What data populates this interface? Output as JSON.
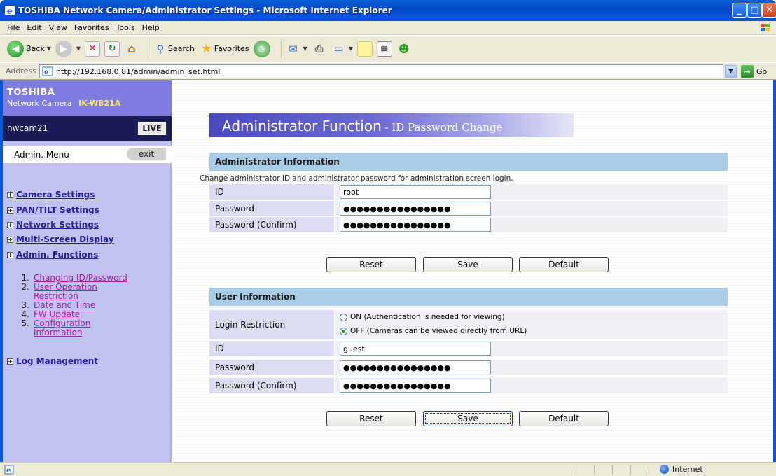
{
  "window": {
    "title": "TOSHIBA Network Camera/Administrator Settings - Microsoft Internet Explorer",
    "min_label": "_",
    "max_label": "□",
    "close_label": "✕"
  },
  "menu": [
    "File",
    "Edit",
    "View",
    "Favorites",
    "Tools",
    "Help"
  ],
  "toolbar": {
    "back": "Back",
    "search": "Search",
    "favorites": "Favorites"
  },
  "address": {
    "label": "Address",
    "url": "http://192.168.0.81/admin/admin_set.html",
    "go": "Go"
  },
  "sidebar": {
    "brand": "TOSHIBA",
    "subtitle": "Network Camera",
    "model": "IK-WB21A",
    "camera_name": "nwcam21",
    "live": "LIVE",
    "admin_menu": "Admin. Menu",
    "exit": "exit",
    "nav": {
      "camera": "Camera Settings",
      "pantilt": "PAN/TILT Settings",
      "network": "Network Settings",
      "multi": "Multi-Screen Display",
      "admin": "Admin. Functions",
      "log": "Log Management"
    },
    "sub": [
      {
        "num": "1.",
        "text": "Changing ID/Password"
      },
      {
        "num": "2.",
        "text": "User Operation"
      },
      {
        "num": "",
        "text": "Restriction"
      },
      {
        "num": "3.",
        "text": "Date and Time"
      },
      {
        "num": "4.",
        "text": "FW Update"
      },
      {
        "num": "5.",
        "text": "Configuration"
      },
      {
        "num": "",
        "text": "Information"
      }
    ]
  },
  "main": {
    "title": "Administrator Function",
    "subtitle": " - ID Password Change",
    "admin": {
      "heading": "Administrator Information",
      "description": "Change administrator ID and administrator password for administration screen login.",
      "id_label": "ID",
      "id_value": "root",
      "pw_label": "Password",
      "pw_value": "●●●●●●●●●●●●●●●●",
      "pwc_label": "Password (Confirm)",
      "pwc_value": "●●●●●●●●●●●●●●●●"
    },
    "user": {
      "heading": "User Information",
      "login_label": "Login Restriction",
      "on_text": "ON (Authentication is needed for viewing)",
      "off_text": "OFF (Cameras can be viewed directly from URL)",
      "id_label": "ID",
      "id_value": "guest",
      "pw_label": "Password",
      "pw_value": "●●●●●●●●●●●●●●●●",
      "pwc_label": "Password (Confirm)",
      "pwc_value": "●●●●●●●●●●●●●●●●"
    },
    "buttons": {
      "reset": "Reset",
      "save": "Save",
      "default": "Default"
    }
  },
  "status": {
    "zone": "Internet"
  },
  "colors": {
    "xp_blue": "#0a55d8",
    "sidebar_bg": "#c2c2f0",
    "section_head": "#a9cde6",
    "nav_link": "#22229a",
    "visited_link": "#a020a0"
  }
}
